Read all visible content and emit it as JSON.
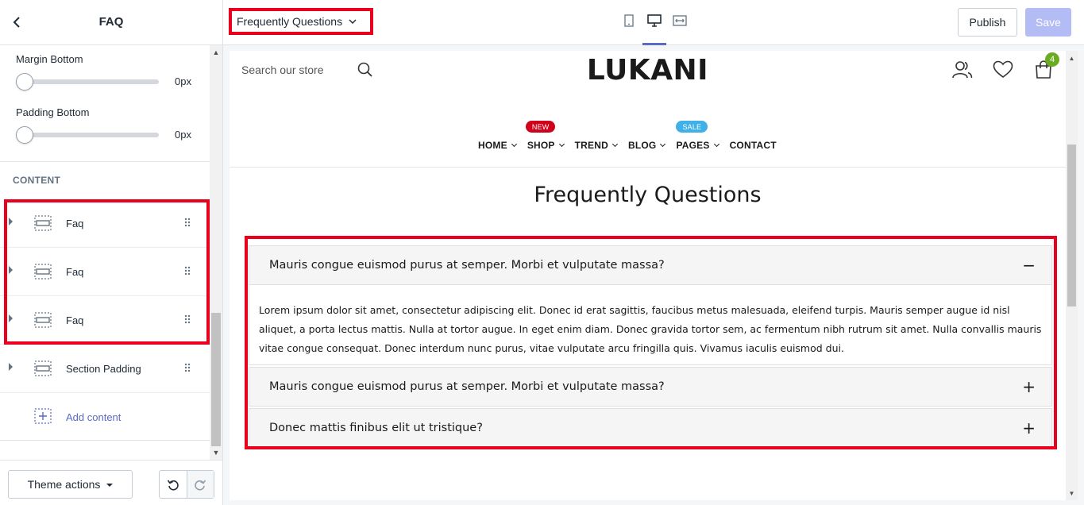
{
  "sidebar": {
    "title": "FAQ",
    "settings": [
      {
        "label": "Margin Bottom",
        "value": "0px"
      },
      {
        "label": "Padding Bottom",
        "value": "0px"
      }
    ],
    "content_heading": "CONTENT",
    "blocks": [
      {
        "label": "Faq"
      },
      {
        "label": "Faq"
      },
      {
        "label": "Faq"
      },
      {
        "label": "Section Padding"
      }
    ],
    "add_content": "Add content",
    "theme_actions": "Theme actions"
  },
  "topbar": {
    "page_select": "Frequently Questions",
    "devices": [
      "mobile-icon",
      "desktop-icon",
      "fullwidth-icon"
    ],
    "active_device": "desktop",
    "publish": "Publish",
    "save": "Save"
  },
  "store": {
    "search_placeholder": "Search our store",
    "logo": "LUKANI",
    "cart_count": "4",
    "nav": [
      {
        "label": "HOME",
        "dropdown": true
      },
      {
        "label": "SHOP",
        "dropdown": true,
        "badge": "NEW"
      },
      {
        "label": "TREND",
        "dropdown": true
      },
      {
        "label": "BLOG",
        "dropdown": true
      },
      {
        "label": "PAGES",
        "dropdown": true,
        "badge": "SALE"
      },
      {
        "label": "CONTACT",
        "dropdown": false
      }
    ],
    "faq_title": "Frequently Questions",
    "faqs": [
      {
        "question": "Mauris congue euismod purus at semper. Morbi et vulputate massa?",
        "toggle": "−",
        "expanded": true,
        "answer": "Lorem ipsum dolor sit amet, consectetur adipiscing elit. Donec id erat sagittis, faucibus metus malesuada, eleifend turpis. Mauris semper augue id nisl aliquet, a porta lectus mattis. Nulla at tortor augue. In eget enim diam. Donec gravida tortor sem, ac fermentum nibh rutrum sit amet. Nulla convallis mauris vitae congue consequat. Donec interdum nunc purus, vitae vulputate arcu fringilla quis. Vivamus iaculis euismod dui."
      },
      {
        "question": "Mauris congue euismod purus at semper. Morbi et vulputate massa?",
        "toggle": "+",
        "expanded": false
      },
      {
        "question": "Donec mattis finibus elit ut tristique?",
        "toggle": "+",
        "expanded": false
      }
    ]
  },
  "colors": {
    "highlight": "#e8001c",
    "accent": "#5c6ac4",
    "save_disabled": "#b3bcf5",
    "badge_new": "#d0021b",
    "badge_sale": "#3fb0e8",
    "cart_badge": "#6aab21"
  }
}
